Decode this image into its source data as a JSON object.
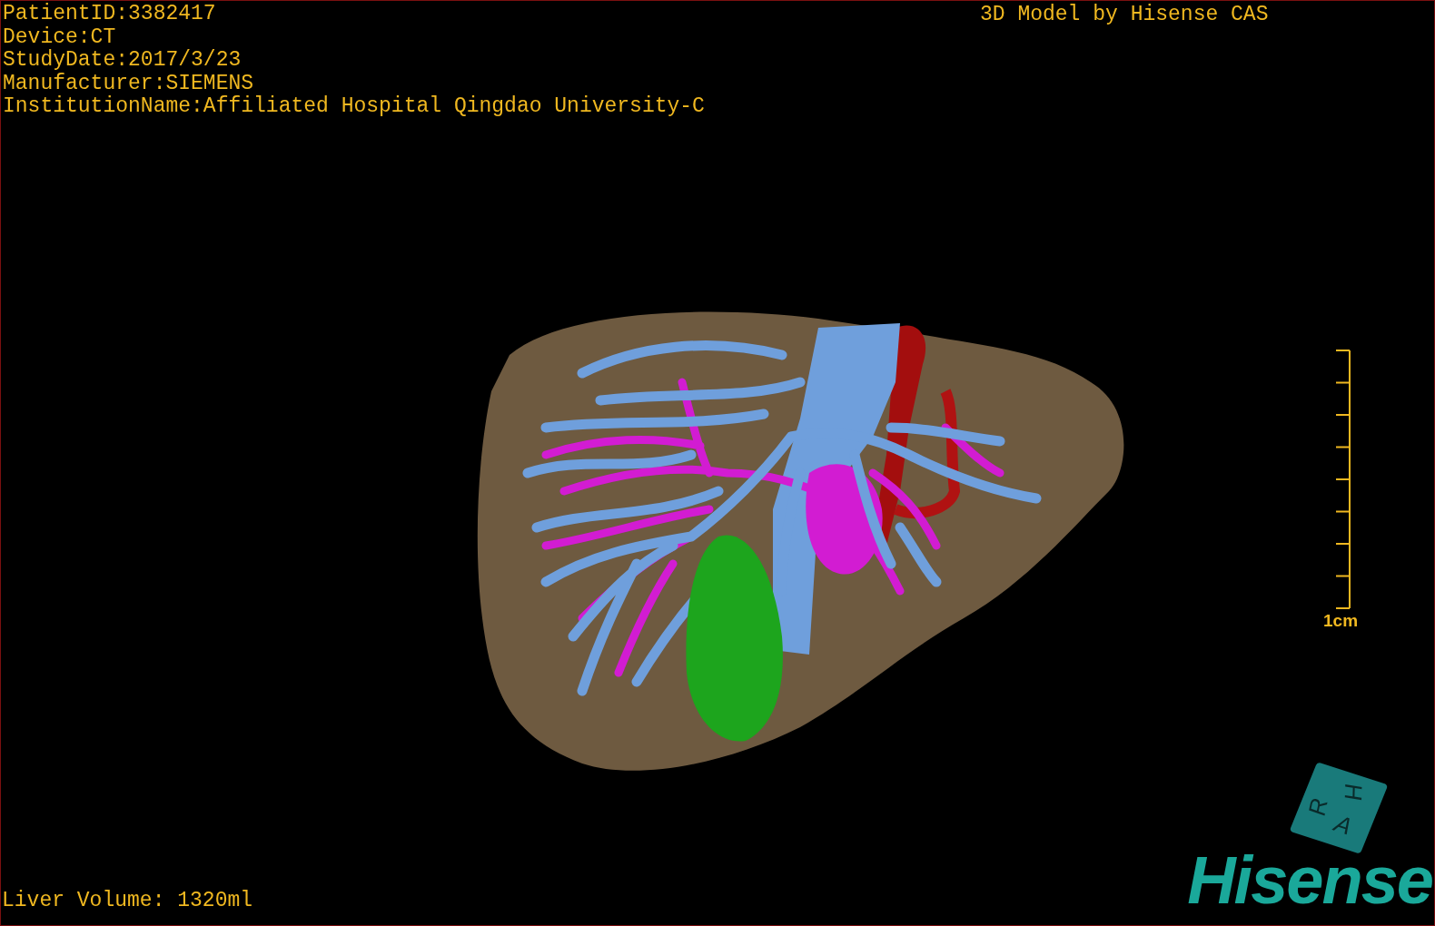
{
  "study_info": [
    "PatientID:3382417",
    "Device:CT",
    "StudyDate:2017/3/23",
    "Manufacturer:SIEMENS",
    "InstitutionName:Affiliated Hospital Qingdao University-C"
  ],
  "title": "3D Model by Hisense CAS",
  "scale_bar": {
    "label": "1cm"
  },
  "orientation_cube": {
    "faces": [
      "H",
      "R",
      "A"
    ]
  },
  "liver_volume": "Liver Volume: 1320ml",
  "logo": "Hisense"
}
